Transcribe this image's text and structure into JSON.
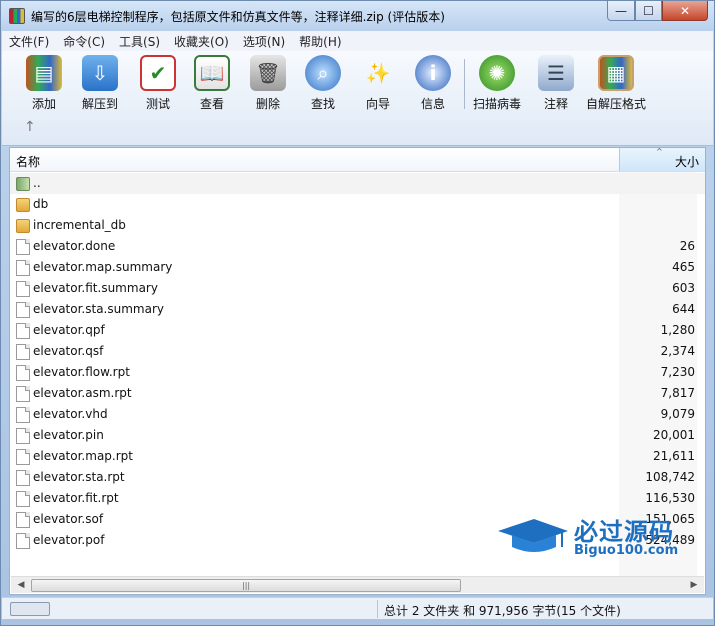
{
  "window": {
    "title": "编写的6层电梯控制程序，包括原文件和仿真文件等，注释详细.zip (评估版本)",
    "controls": {
      "minimize": "—",
      "maximize": "☐",
      "close": "✕"
    }
  },
  "menu": [
    "文件(F)",
    "命令(C)",
    "工具(S)",
    "收藏夹(O)",
    "选项(N)",
    "帮助(H)"
  ],
  "toolbar": {
    "buttons": [
      {
        "label": "添加",
        "icon": "add-archive-icon"
      },
      {
        "label": "解压到",
        "icon": "extract-to-icon"
      },
      {
        "label": "测试",
        "icon": "test-icon"
      },
      {
        "label": "查看",
        "icon": "view-icon"
      },
      {
        "label": "删除",
        "icon": "delete-icon"
      },
      {
        "label": "查找",
        "icon": "find-icon"
      },
      {
        "label": "向导",
        "icon": "wizard-icon"
      },
      {
        "label": "信息",
        "icon": "info-icon"
      },
      {
        "label": "扫描病毒",
        "icon": "virus-scan-icon"
      },
      {
        "label": "注释",
        "icon": "comment-icon"
      },
      {
        "label": "自解压格式",
        "icon": "sfx-icon"
      }
    ],
    "up_arrow": "↑"
  },
  "list": {
    "columns": {
      "name": "名称",
      "size": "大小",
      "sort_indicator": "^"
    },
    "rows": [
      {
        "name": "..",
        "size": "",
        "type": "up"
      },
      {
        "name": "db",
        "size": "",
        "type": "folder"
      },
      {
        "name": "incremental_db",
        "size": "",
        "type": "folder"
      },
      {
        "name": "elevator.done",
        "size": "26",
        "type": "file"
      },
      {
        "name": "elevator.map.summary",
        "size": "465",
        "type": "file"
      },
      {
        "name": "elevator.fit.summary",
        "size": "603",
        "type": "file"
      },
      {
        "name": "elevator.sta.summary",
        "size": "644",
        "type": "file"
      },
      {
        "name": "elevator.qpf",
        "size": "1,280",
        "type": "file"
      },
      {
        "name": "elevator.qsf",
        "size": "2,374",
        "type": "file"
      },
      {
        "name": "elevator.flow.rpt",
        "size": "7,230",
        "type": "file"
      },
      {
        "name": "elevator.asm.rpt",
        "size": "7,817",
        "type": "file"
      },
      {
        "name": "elevator.vhd",
        "size": "9,079",
        "type": "file"
      },
      {
        "name": "elevator.pin",
        "size": "20,001",
        "type": "file"
      },
      {
        "name": "elevator.map.rpt",
        "size": "21,611",
        "type": "file"
      },
      {
        "name": "elevator.sta.rpt",
        "size": "108,742",
        "type": "file"
      },
      {
        "name": "elevator.fit.rpt",
        "size": "116,530",
        "type": "file"
      },
      {
        "name": "elevator.sof",
        "size": "151,065",
        "type": "file"
      },
      {
        "name": "elevator.pof",
        "size": "524,489",
        "type": "file"
      }
    ]
  },
  "watermark": {
    "line1": "必过源码",
    "line2": "Biguo100.com"
  },
  "scrollbar": {
    "left": "◀",
    "right": "▶",
    "grip": "|||"
  },
  "status": {
    "summary": "总计 2 文件夹 和 971,956 字节(15 个文件)"
  }
}
